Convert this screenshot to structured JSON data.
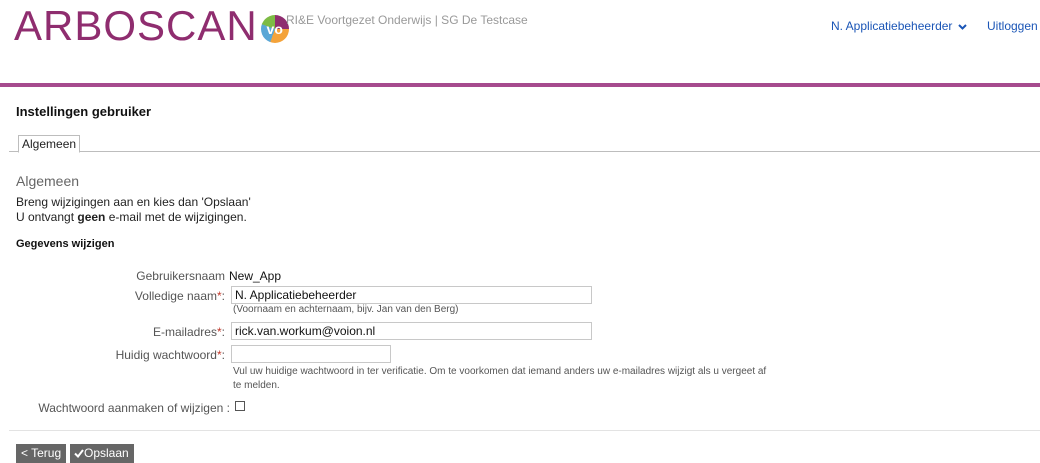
{
  "header": {
    "logo_text": "ARBOSCAN",
    "logo_badge": "vo",
    "organization": "RI&E Voortgezet Onderwijs  |  SG De Testcase",
    "user_menu_label": "N. Applicatiebeheerder",
    "logout_label": "Uitloggen"
  },
  "page": {
    "title": "Instellingen gebruiker",
    "tabs": [
      {
        "label": "Algemeen"
      }
    ],
    "section_title": "Algemeen",
    "intro_line1": "Breng wijzigingen aan en kies dan 'Opslaan'",
    "intro_line2_pre": "U ontvangt ",
    "intro_line2_bold": "geen",
    "intro_line2_post": " e-mail met de wijzigingen.",
    "subsection_title": "Gegevens wijzigen"
  },
  "form": {
    "username_label": "Gebruikersnaam",
    "username_value": "New_App",
    "fullname_label": "Volledige naam",
    "fullname_value": "N. Applicatiebeheerder",
    "fullname_hint": "(Voornaam en achternaam, bijv. Jan van den Berg)",
    "email_label": "E-mailadres",
    "email_value": "rick.van.workum@voion.nl",
    "password_label": "Huidig wachtwoord",
    "password_value": "",
    "password_hint_line1": "Vul uw huidige wachtwoord in ter verificatie. Om te voorkomen dat iemand anders uw e-mailadres wijzigt als u vergeet af",
    "password_hint_line2": "te melden.",
    "change_password_label": "Wachtwoord aanmaken of wijzigen :",
    "change_password_checked": false,
    "required_marker": "*",
    "label_colon": ":"
  },
  "buttons": {
    "back_label": "< Terug",
    "save_label": "Opslaan"
  },
  "colors": {
    "brand": "#8f2d6f",
    "bar": "#a64b8e",
    "link": "#1a55b6",
    "button_bg": "#666666"
  }
}
